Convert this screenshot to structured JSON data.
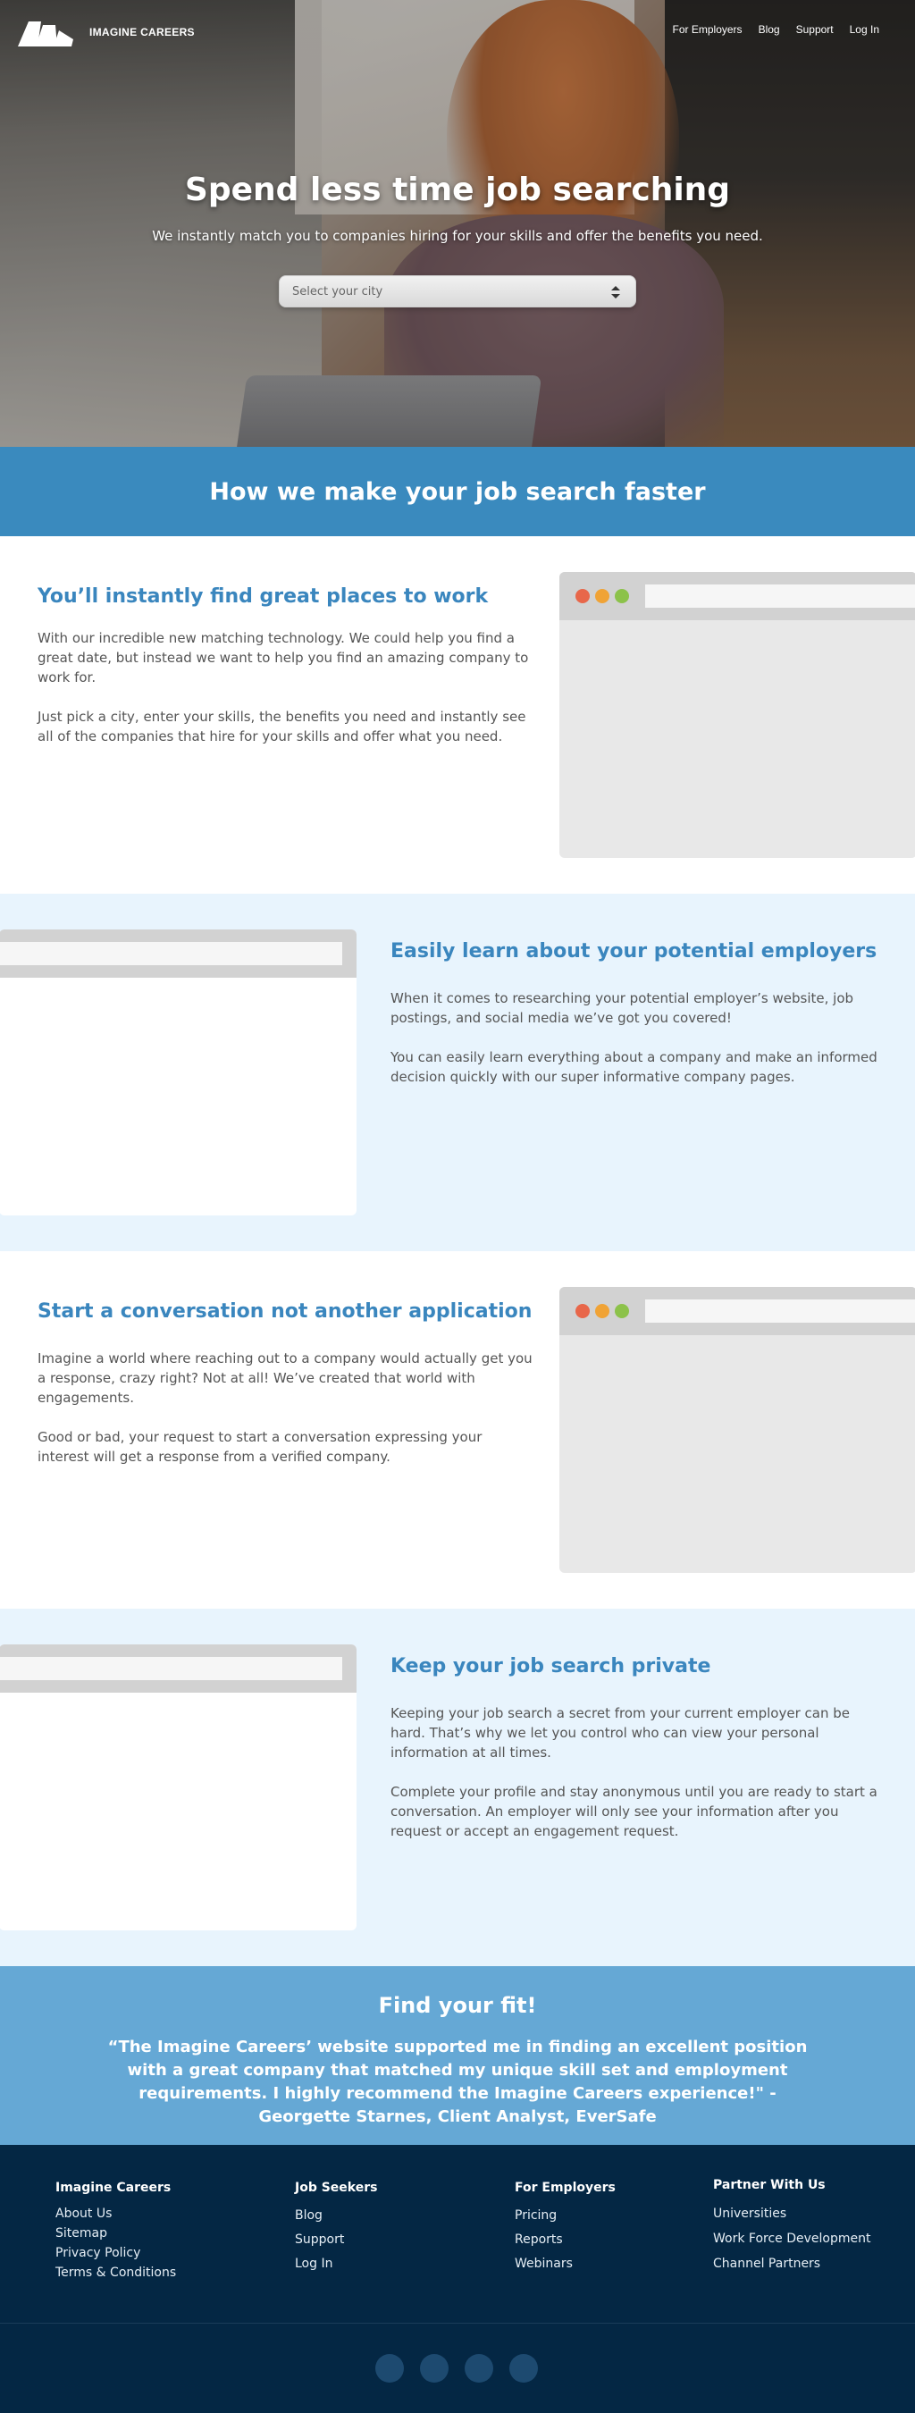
{
  "header": {
    "logo_text": "IMAGINE CAREERS",
    "nav": [
      "For Employers",
      "Blog",
      "Support",
      "Log In"
    ]
  },
  "hero": {
    "title": "Spend less time job searching",
    "subtitle": "We instantly match you to companies hiring for your skills and offer the benefits you need.",
    "city_select_placeholder": "Select your city"
  },
  "banner": {
    "title": "How we make your job search faster"
  },
  "features": [
    {
      "title": "You’ll instantly find great places to work",
      "p1": "With our incredible new matching technology. We could help you find a great date, but instead we want to help you find an amazing company to work for.",
      "p2": "Just pick a city, enter your skills, the benefits you need and instantly see all of the companies that hire for your skills and offer what you need."
    },
    {
      "title": "Easily learn about your potential employers",
      "p1": "When it comes to researching your potential employer’s website, job postings, and social media we’ve got you covered!",
      "p2": "You can easily learn everything about a company and make an informed decision quickly with our super informative company pages."
    },
    {
      "title": "Start a conversation not another application",
      "p1": "Imagine a world where reaching out to a company would actually get you a response, crazy right? Not at all! We’ve created that world with engagements.",
      "p2": "Good or bad, your request to start a conversation expressing your interest will get a response from a verified company."
    },
    {
      "title": "Keep your job search private",
      "p1": "Keeping your job search a secret from your current employer can be hard. That’s why we let you control who can view your personal information at all times.",
      "p2": "Complete your profile and stay anonymous until you are ready to start a conversation. An employer will only see your information after you request or accept an engagement request."
    }
  ],
  "testimonial": {
    "title": "Find your fit!",
    "quote": "“The Imagine Careers’ website supported me in finding an excellent position with a great company that matched my unique skill set and employment requirements. I highly recommend the Imagine Careers experience!\" - Georgette Starnes, Client Analyst, EverSafe"
  },
  "footer": {
    "columns": [
      {
        "title": "Imagine Careers",
        "links": [
          "About Us",
          "Sitemap",
          "Privacy Policy",
          "Terms & Conditions"
        ]
      },
      {
        "title": "Job Seekers",
        "links": [
          "Blog",
          "Support",
          "Log In"
        ]
      },
      {
        "title": "For Employers",
        "links": [
          "Pricing",
          "Reports",
          "Webinars"
        ]
      },
      {
        "title": "Partner With Us",
        "links": [
          "Universities",
          "Work Force Development",
          "Channel Partners"
        ]
      }
    ]
  },
  "colors": {
    "brand_blue": "#3a8abe",
    "heading_blue": "#3a86be",
    "light_blue_bg": "#e8f4fd",
    "testimonial_bg": "#65a8d5",
    "footer_bg": "#042744",
    "dot_red": "#e8674a",
    "dot_orange": "#f0a336",
    "dot_green": "#8cc24a"
  }
}
